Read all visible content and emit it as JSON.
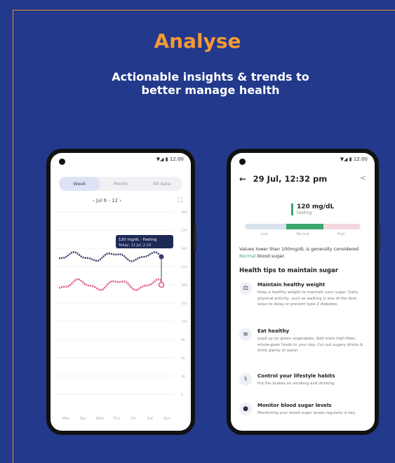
{
  "page": {
    "title": "Analyse",
    "subtitle": "Actionable insights & trends to better manage health"
  },
  "phone1": {
    "status_icons": "▼◢ ▮ 12:00",
    "tabs": [
      "Week",
      "Month",
      "All data"
    ],
    "date_range": "‹  Jul 6 - 12  ›",
    "expand_icon": "⛶",
    "tooltip_line1": "120 mg/dL · Fasting",
    "tooltip_line2": "Today, 11 Jul, 2:19",
    "x_labels": [
      "Mon",
      "Tue",
      "Wed",
      "Thu",
      "Fri",
      "Sat",
      "Sun"
    ],
    "y_labels": [
      "300",
      "270",
      "240",
      "210",
      "180",
      "150",
      "120",
      "90",
      "60",
      "30",
      "0"
    ]
  },
  "phone2": {
    "status_icons": "▼◢ ▮ 12:00",
    "back_icon": "←",
    "header": "29 Jul, 12:32 pm",
    "share_icon": "<",
    "reading_value": "120 mg/dL",
    "reading_sub": "Fasting",
    "range_labels": [
      "Low",
      "Normal",
      "High"
    ],
    "note_pre": "Values lower than 100mg/dL is generally considered ",
    "note_highlight": "Normal",
    "note_post": " blood sugar.",
    "tips_title": "Health tips to maintain sugar",
    "tips": [
      {
        "icon": "⚖",
        "title": "Maintain healthy weight",
        "desc": "Keep a healthy weight to maintain your sugar. Daily physical activity, such as walking is one of the best ways to delay or prevent type 2 diabetes."
      },
      {
        "icon": "≡",
        "title": "Eat healthy",
        "desc": "Load up on green vegetables. Add more high-fiber, whole-grain foods to your day. Cut out sugary drinks & drink plenty of water."
      },
      {
        "icon": "⚕",
        "title": "Control your lifestyle habits",
        "desc": "Put the brakes on smoking and drinking."
      },
      {
        "icon": "●",
        "title": "Monitor blood sugar levels",
        "desc": "Monitoring your blood sugar levels regularly is key."
      }
    ]
  },
  "colors": {
    "background": "#22398c",
    "accent": "#f39a35",
    "series_top": "#3d3f6b",
    "series_bottom": "#e0528a",
    "normal_green": "#3ca66c"
  }
}
